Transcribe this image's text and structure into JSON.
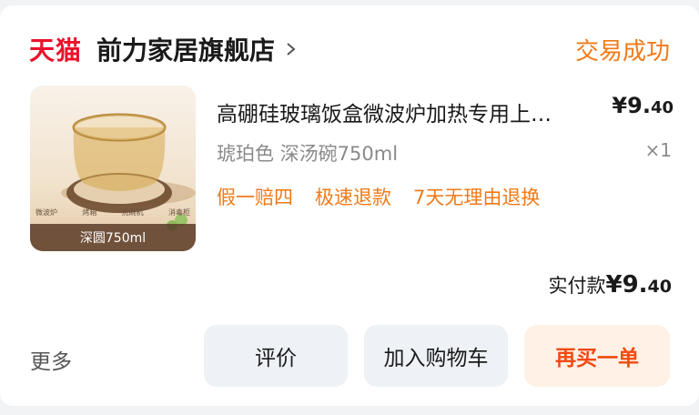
{
  "shop": {
    "brand": "天猫",
    "name": "前力家居旗舰店",
    "order_status": "交易成功"
  },
  "product": {
    "title": "高硼硅玻璃饭盒微波炉加热专用上…",
    "price_main": "¥9.",
    "price_cents": "40",
    "sku": "琥珀色 深汤碗750ml",
    "quantity": "×1",
    "image_caption": "深圆750ml",
    "image_icons": [
      "微波炉",
      "烤箱",
      "洗碗机",
      "消毒柜"
    ],
    "tags": [
      "假一赔四",
      "极速退款",
      "7天无理由退换"
    ]
  },
  "payment": {
    "label": "实付款",
    "amount_main": "¥9.",
    "amount_cents": "40"
  },
  "actions": {
    "more": "更多",
    "review": "评价",
    "add_cart": "加入购物车",
    "rebuy": "再买一单"
  },
  "colors": {
    "brand_red": "#e8132a",
    "status_orange": "#f07a18",
    "rebuy_text": "#f04a12",
    "rebuy_bg": "#fff1e6",
    "button_bg": "#eef1f6"
  }
}
